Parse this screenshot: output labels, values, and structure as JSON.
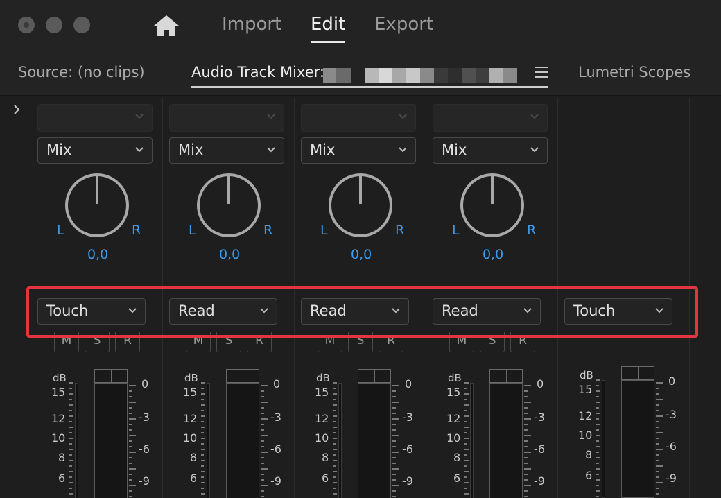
{
  "titlebar": {
    "tabs": [
      {
        "label": "Import",
        "active": false
      },
      {
        "label": "Edit",
        "active": true
      },
      {
        "label": "Export",
        "active": false
      }
    ],
    "home_icon": "home-icon"
  },
  "panel_tabs": {
    "source": "Source: (no clips)",
    "mixer": "Audio Track Mixer:",
    "lumetri": "Lumetri Scopes"
  },
  "strips": [
    {
      "pan_mode": "Mix",
      "pan_value": "0,0",
      "automation": "Touch",
      "has_pan": true
    },
    {
      "pan_mode": "Mix",
      "pan_value": "0,0",
      "automation": "Read",
      "has_pan": true
    },
    {
      "pan_mode": "Mix",
      "pan_value": "0,0",
      "automation": "Read",
      "has_pan": true
    },
    {
      "pan_mode": "Mix",
      "pan_value": "0,0",
      "automation": "Read",
      "has_pan": true
    },
    {
      "automation": "Touch",
      "has_pan": false
    }
  ],
  "labels": {
    "left": "L",
    "right": "R",
    "mute": "M",
    "solo": "S",
    "record": "R",
    "db": "dB"
  },
  "meter_scale_left": [
    "15",
    "12",
    "10",
    "8",
    "6"
  ],
  "fader_scale_right": [
    "0",
    "-3",
    "-6",
    "-9"
  ],
  "colors": {
    "accent_blue": "#3d9ae8",
    "highlight_red": "#e5333f"
  }
}
